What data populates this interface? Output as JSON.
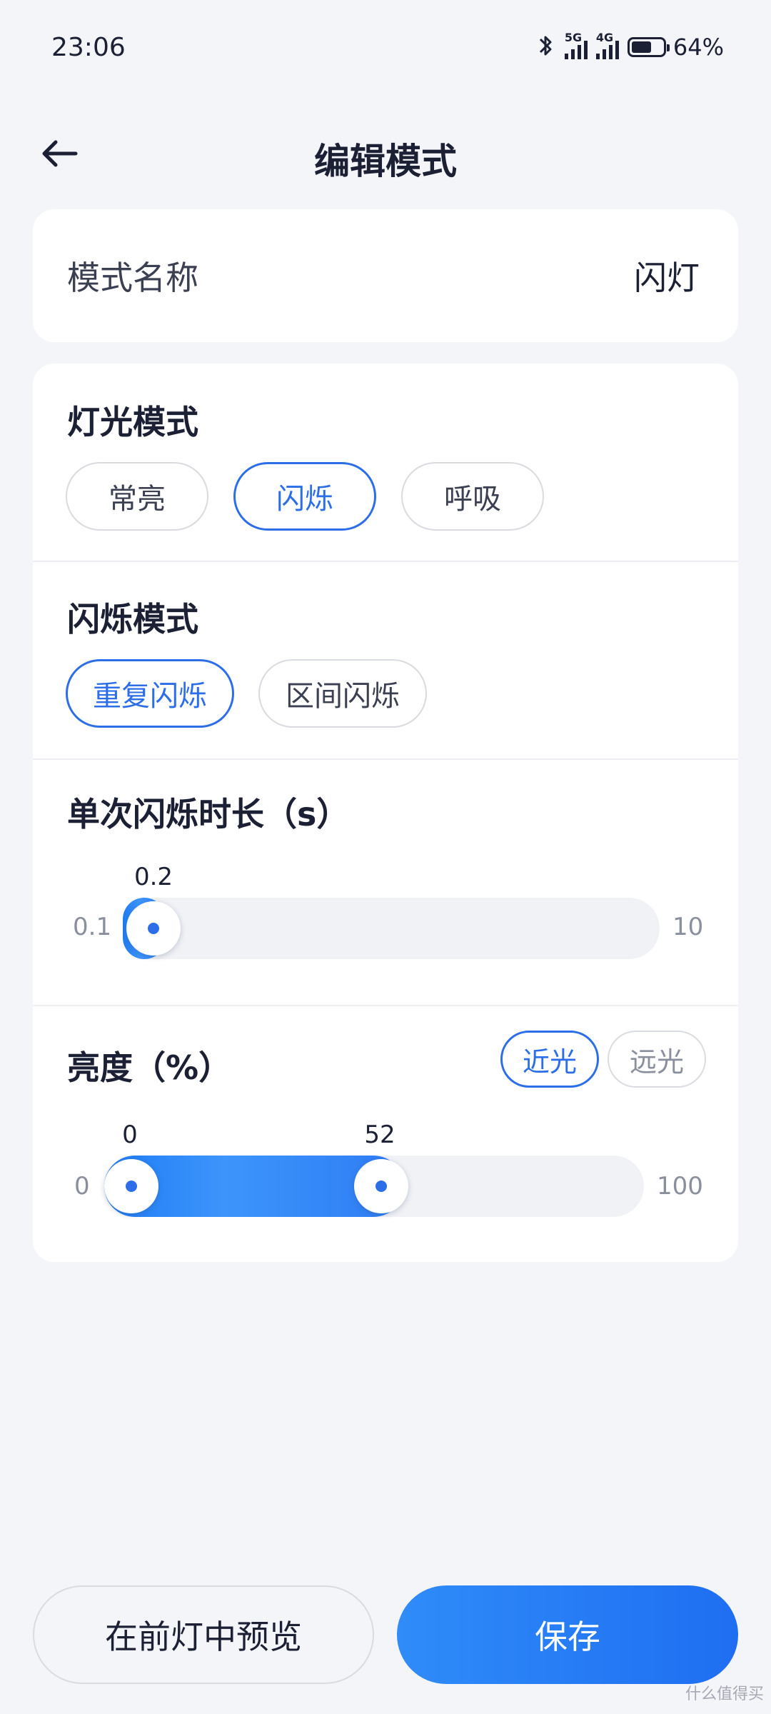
{
  "status_bar": {
    "time": "23:06",
    "net1": "5G",
    "net2": "4G",
    "battery_pct": "64%",
    "battery_level": 0.64
  },
  "header": {
    "title": "编辑模式"
  },
  "name_row": {
    "label": "模式名称",
    "value": "闪灯"
  },
  "light_mode": {
    "title": "灯光模式",
    "options": [
      "常亮",
      "闪烁",
      "呼吸"
    ],
    "selected": "闪烁"
  },
  "flash_mode": {
    "title": "闪烁模式",
    "options": [
      "重复闪烁",
      "区间闪烁"
    ],
    "selected": "重复闪烁"
  },
  "flash_duration": {
    "title": "单次闪烁时长（s）",
    "min": "0.1",
    "max": "10",
    "value": "0.2"
  },
  "brightness": {
    "title": "亮度（%）",
    "beam_options": [
      "近光",
      "远光"
    ],
    "selected_beam": "近光",
    "min": "0",
    "max": "100",
    "low_value": "0",
    "high_value": "52"
  },
  "actions": {
    "preview_label": "在前灯中预览",
    "save_label": "保存"
  },
  "watermark": "什么值得买",
  "colors": {
    "accent": "#2c6ee8",
    "background": "#f4f5f9",
    "card": "#ffffff"
  }
}
